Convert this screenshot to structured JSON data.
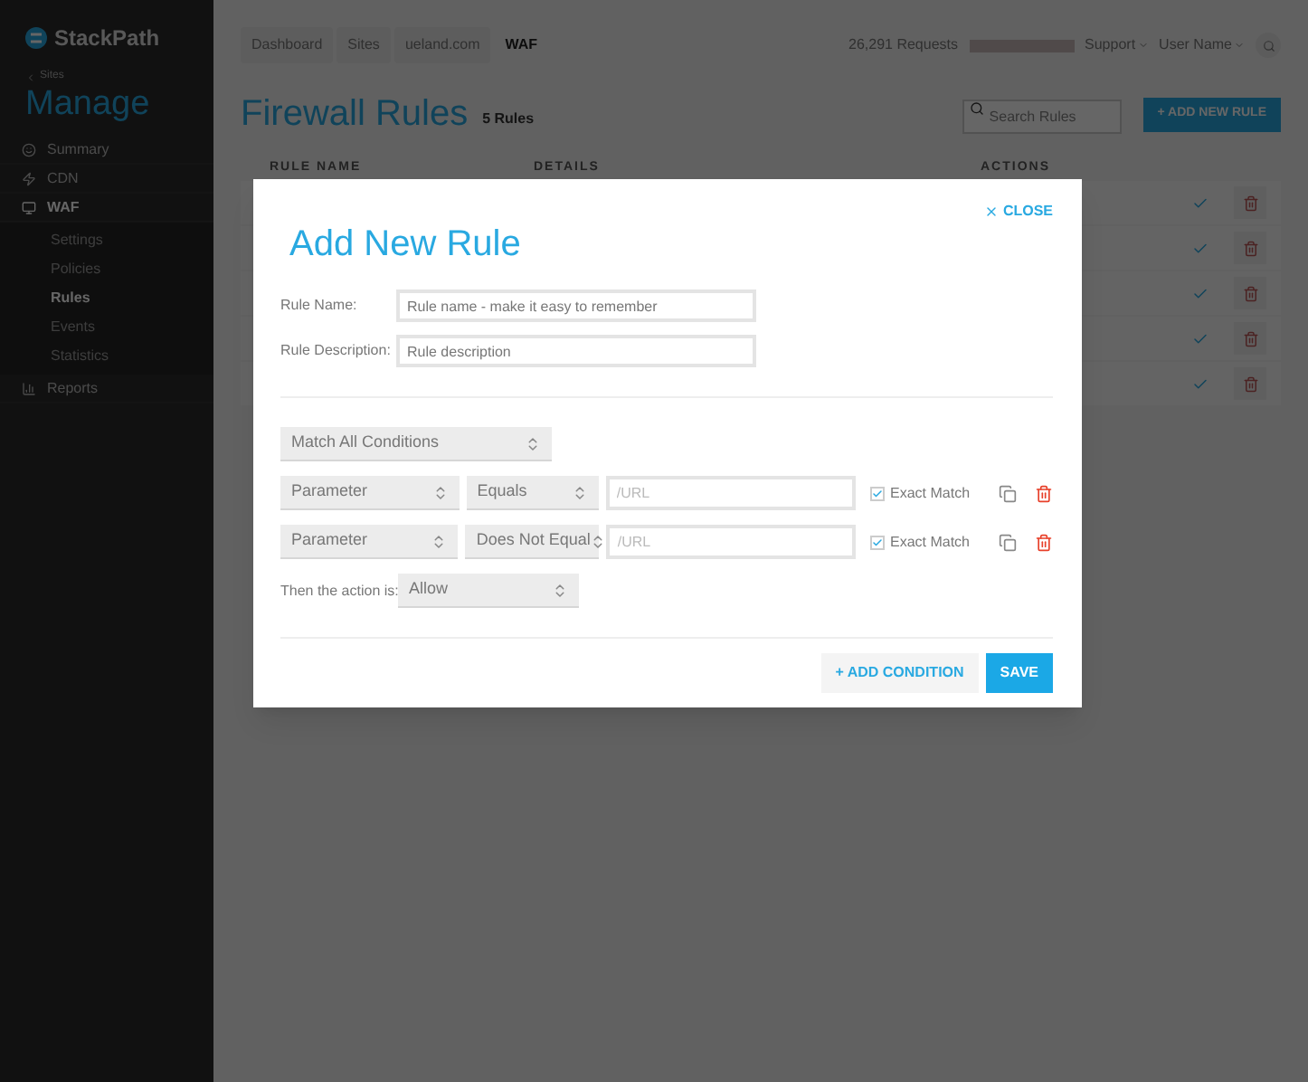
{
  "sidebar": {
    "logo": "StackPath",
    "back_link": "Sites",
    "heading": "Manage",
    "items": [
      {
        "label": "Summary",
        "selected": false
      },
      {
        "label": "CDN",
        "selected": false
      },
      {
        "label": "WAF",
        "selected": true,
        "children": [
          {
            "label": "Settings",
            "selected": false
          },
          {
            "label": "Policies",
            "selected": false
          },
          {
            "label": "Rules",
            "selected": true
          },
          {
            "label": "Events",
            "selected": false
          },
          {
            "label": "Statistics",
            "selected": false
          }
        ]
      },
      {
        "label": "Reports",
        "selected": false
      }
    ]
  },
  "breadcrumbs": [
    {
      "label": "Dashboard",
      "selected": false
    },
    {
      "label": "Sites",
      "selected": false
    },
    {
      "label": "ueland.com",
      "selected": false
    },
    {
      "label": "WAF",
      "selected": true
    }
  ],
  "topbar": {
    "requests": "26,291 Requests",
    "menus": [
      "Support",
      "User Name"
    ]
  },
  "page": {
    "title": "Firewall Rules",
    "count": "5 Rules",
    "search": {
      "placeholder": "Search Rules"
    },
    "add_button": "+ ADD NEW RULE"
  },
  "table": {
    "columns": [
      "RULE NAME",
      "DETAILS",
      "ACTIONS"
    ],
    "rows": [
      {
        "enabled": true
      },
      {
        "enabled": true
      },
      {
        "enabled": true
      },
      {
        "enabled": true
      },
      {
        "enabled": true
      }
    ]
  },
  "modal": {
    "title": "Add New Rule",
    "close": "CLOSE",
    "fields": [
      {
        "label": "Rule Name:",
        "placeholder": "Rule name - make it easy to remember"
      },
      {
        "label": "Rule Description:",
        "placeholder": "Rule description"
      }
    ],
    "match": "Match All Conditions",
    "conditions": [
      {
        "field": "Parameter",
        "operator": "Equals",
        "placeholder": "/URL",
        "exact_match": "Exact Match",
        "checked": true
      },
      {
        "field": "Parameter",
        "operator": "Does Not Equal",
        "placeholder": "/URL",
        "exact_match": "Exact Match",
        "checked": true
      }
    ],
    "action_label": "Then the action is:",
    "action": "Allow",
    "buttons": [
      {
        "label": "+ ADD CONDITION",
        "kind": "secondary"
      },
      {
        "label": "SAVE",
        "kind": "primary"
      }
    ]
  }
}
